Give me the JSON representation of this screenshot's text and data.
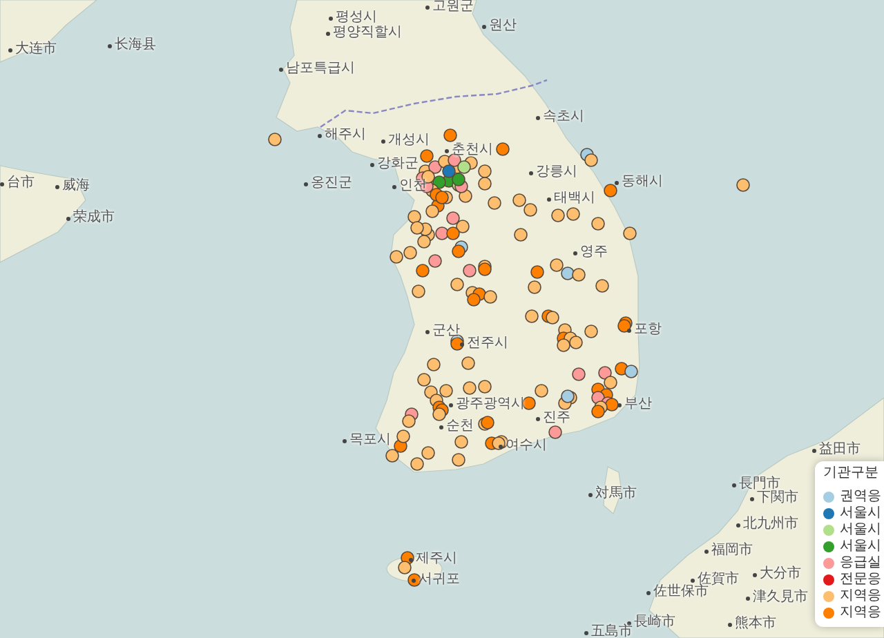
{
  "map": {
    "places": [
      {
        "name": "고원군"
      },
      {
        "name": "평성시"
      },
      {
        "name": "원산"
      },
      {
        "name": "평양직할시"
      },
      {
        "name": "大连市"
      },
      {
        "name": "长海县"
      },
      {
        "name": "남포특급시"
      },
      {
        "name": "속초시"
      },
      {
        "name": "해주시"
      },
      {
        "name": "개성시"
      },
      {
        "name": "춘천시"
      },
      {
        "name": "강화군"
      },
      {
        "name": "강릉시"
      },
      {
        "name": "台市"
      },
      {
        "name": "威海"
      },
      {
        "name": "옹진군"
      },
      {
        "name": "인천"
      },
      {
        "name": "동해시"
      },
      {
        "name": "태백시"
      },
      {
        "name": "荣成市"
      },
      {
        "name": "영주"
      },
      {
        "name": "군산"
      },
      {
        "name": "포항"
      },
      {
        "name": "전주시"
      },
      {
        "name": "광주광역시"
      },
      {
        "name": "부산"
      },
      {
        "name": "진주"
      },
      {
        "name": "순천"
      },
      {
        "name": "목포시"
      },
      {
        "name": "여수시"
      },
      {
        "name": "益田市"
      },
      {
        "name": "長門市"
      },
      {
        "name": "対馬市"
      },
      {
        "name": "下関市"
      },
      {
        "name": "北九州市"
      },
      {
        "name": "福岡市"
      },
      {
        "name": "제주시"
      },
      {
        "name": "서귀포"
      },
      {
        "name": "佐賀市"
      },
      {
        "name": "大分市"
      },
      {
        "name": "佐世保市"
      },
      {
        "name": "津久見市"
      },
      {
        "name": "長崎市"
      },
      {
        "name": "熊本市"
      },
      {
        "name": "五島市"
      }
    ],
    "markers": [
      {
        "color": "#fdbf6f"
      },
      {
        "color": "#fdbf6f"
      },
      {
        "color": "#a6cee3"
      },
      {
        "color": "#fdbf6f"
      },
      {
        "color": "#ff7f00"
      },
      {
        "color": "#ff7f00"
      },
      {
        "color": "#ff7f00"
      },
      {
        "color": "#fdbf6f"
      },
      {
        "color": "#fdbf6f"
      },
      {
        "color": "#fdbf6f"
      },
      {
        "color": "#fdbf6f"
      },
      {
        "color": "#fdbf6f"
      },
      {
        "color": "#fdbf6f"
      },
      {
        "color": "#fdbf6f"
      },
      {
        "color": "#fdbf6f"
      },
      {
        "color": "#fdbf6f"
      },
      {
        "color": "#fdbf6f"
      },
      {
        "color": "#fdbf6f"
      },
      {
        "color": "#ff7f00"
      },
      {
        "color": "#fdbf6f"
      },
      {
        "color": "#fb9a99"
      },
      {
        "color": "#fdbf6f"
      },
      {
        "color": "#fdbf6f"
      },
      {
        "color": "#fdbf6f"
      },
      {
        "color": "#fdbf6f"
      },
      {
        "color": "#fdbf6f"
      },
      {
        "color": "#fdbf6f"
      },
      {
        "color": "#fb9a99"
      },
      {
        "color": "#fdbf6f"
      },
      {
        "color": "#fb9a99"
      },
      {
        "color": "#b2df8a"
      },
      {
        "color": "#33a02c"
      },
      {
        "color": "#33a02c"
      },
      {
        "color": "#b2df8a"
      },
      {
        "color": "#1f78b4"
      },
      {
        "color": "#fdbf6f"
      },
      {
        "color": "#ff7f00"
      },
      {
        "color": "#fb9a99"
      },
      {
        "color": "#ff7f00"
      },
      {
        "color": "#fb9a99"
      },
      {
        "color": "#33a02c"
      },
      {
        "color": "#ff7f00"
      },
      {
        "color": "#fb9a99"
      },
      {
        "color": "#fdbf6f"
      },
      {
        "color": "#fb9a99"
      },
      {
        "color": "#ff7f00"
      },
      {
        "color": "#a6cee3"
      },
      {
        "color": "#ff7f00"
      },
      {
        "color": "#fdbf6f"
      },
      {
        "color": "#fdbf6f"
      },
      {
        "color": "#fdbf6f"
      },
      {
        "color": "#fb9a99"
      },
      {
        "color": "#ff7f00"
      },
      {
        "color": "#fb9a99"
      },
      {
        "color": "#fdbf6f"
      },
      {
        "color": "#ff7f00"
      },
      {
        "color": "#fdbf6f"
      },
      {
        "color": "#ff7f00"
      },
      {
        "color": "#fdbf6f"
      },
      {
        "color": "#a6cee3"
      },
      {
        "color": "#fdbf6f"
      },
      {
        "color": "#fdbf6f"
      },
      {
        "color": "#fdbf6f"
      },
      {
        "color": "#fdbf6f"
      },
      {
        "color": "#fdbf6f"
      },
      {
        "color": "#fdbf6f"
      },
      {
        "color": "#fdbf6f"
      },
      {
        "color": "#fdbf6f"
      },
      {
        "color": "#ff7f00"
      },
      {
        "color": "#fdbf6f"
      },
      {
        "color": "#fdbf6f"
      },
      {
        "color": "#ff7f00"
      },
      {
        "color": "#ff7f00"
      },
      {
        "color": "#fdbf6f"
      },
      {
        "color": "#fdbf6f"
      },
      {
        "color": "#fdbf6f"
      },
      {
        "color": "#ff7f00"
      },
      {
        "color": "#fdbf6f"
      },
      {
        "color": "#fdbf6f"
      },
      {
        "color": "#fdbf6f"
      },
      {
        "color": "#ff7f00"
      },
      {
        "color": "#ff7f00"
      },
      {
        "color": "#a6cee3"
      },
      {
        "color": "#ff7f00"
      },
      {
        "color": "#fdbf6f"
      },
      {
        "color": "#fdbf6f"
      },
      {
        "color": "#fb9a99"
      },
      {
        "color": "#fb9a99"
      },
      {
        "color": "#ff7f00"
      },
      {
        "color": "#a6cee3"
      },
      {
        "color": "#fdbf6f"
      },
      {
        "color": "#fdbf6f"
      },
      {
        "color": "#fdbf6f"
      },
      {
        "color": "#fdbf6f"
      },
      {
        "color": "#fdbf6f"
      },
      {
        "color": "#fdbf6f"
      },
      {
        "color": "#fdbf6f"
      },
      {
        "color": "#ff7f00"
      },
      {
        "color": "#ff7f00"
      },
      {
        "color": "#fdbf6f"
      },
      {
        "color": "#ff7f00"
      },
      {
        "color": "#ff7f00"
      },
      {
        "color": "#fb9a99"
      },
      {
        "color": "#fb9a99"
      },
      {
        "color": "#ff7f00"
      },
      {
        "color": "#fdbf6f"
      },
      {
        "color": "#ff7f00"
      },
      {
        "color": "#fdbf6f"
      },
      {
        "color": "#fdbf6f"
      },
      {
        "color": "#a6cee3"
      },
      {
        "color": "#fdbf6f"
      },
      {
        "color": "#ff7f00"
      },
      {
        "color": "#fb9a99"
      },
      {
        "color": "#fdbf6f"
      },
      {
        "color": "#fdbf6f"
      },
      {
        "color": "#ff7f00"
      },
      {
        "color": "#fb9a99"
      },
      {
        "color": "#ff7f00"
      },
      {
        "color": "#fdbf6f"
      },
      {
        "color": "#fdbf6f"
      },
      {
        "color": "#ff7f00"
      },
      {
        "color": "#fdbf6f"
      },
      {
        "color": "#fdbf6f"
      },
      {
        "color": "#fdbf6f"
      },
      {
        "color": "#fdbf6f"
      },
      {
        "color": "#fdbf6f"
      },
      {
        "color": "#fdbf6f"
      },
      {
        "color": "#ff7f00"
      },
      {
        "color": "#fdbf6f"
      },
      {
        "color": "#ff7f00"
      }
    ]
  },
  "legend": {
    "title": "기관구분",
    "items": [
      {
        "label": "권역응",
        "color": "#a6cee3"
      },
      {
        "label": "서울시",
        "color": "#1f78b4"
      },
      {
        "label": "서울시",
        "color": "#b2df8a"
      },
      {
        "label": "서울시",
        "color": "#33a02c"
      },
      {
        "label": "응급실",
        "color": "#fb9a99"
      },
      {
        "label": "전문응",
        "color": "#e31a1c"
      },
      {
        "label": "지역응",
        "color": "#fdbf6f"
      },
      {
        "label": "지역응",
        "color": "#ff7f00"
      }
    ]
  }
}
